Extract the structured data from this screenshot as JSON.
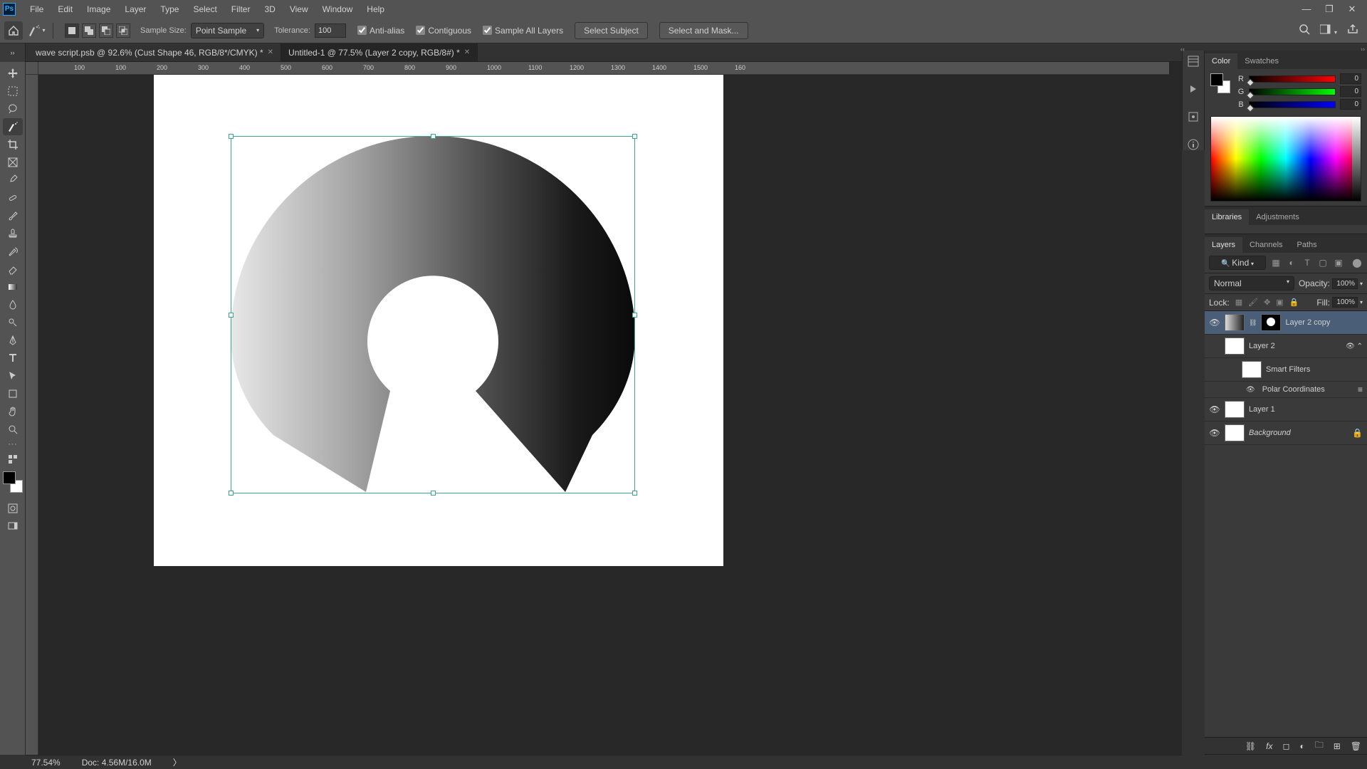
{
  "menu": [
    "File",
    "Edit",
    "Image",
    "Layer",
    "Type",
    "Select",
    "Filter",
    "3D",
    "View",
    "Window",
    "Help"
  ],
  "options": {
    "sample_size_label": "Sample Size:",
    "sample_size_value": "Point Sample",
    "tolerance_label": "Tolerance:",
    "tolerance_value": "100",
    "antialias": "Anti-alias",
    "contiguous": "Contiguous",
    "sample_all": "Sample All Layers",
    "select_subject": "Select Subject",
    "select_and_mask": "Select and Mask..."
  },
  "tabs": [
    {
      "title": "wave script.psb @ 92.6% (Cust Shape 46, RGB/8*/CMYK) *",
      "active": false
    },
    {
      "title": "Untitled-1 @ 77.5% (Layer 2 copy, RGB/8#) *",
      "active": true
    }
  ],
  "ruler_ticks": [
    "100",
    "100",
    "200",
    "300",
    "400",
    "500",
    "600",
    "700",
    "800",
    "900",
    "1000",
    "1100",
    "1200",
    "1300",
    "1400",
    "1500",
    "160"
  ],
  "status": {
    "zoom": "77.54%",
    "doc": "Doc: 4.56M/16.0M"
  },
  "color": {
    "r": "0",
    "g": "0",
    "b": "0"
  },
  "panels": {
    "color_tab": "Color",
    "swatches_tab": "Swatches",
    "libraries_tab": "Libraries",
    "adjustments_tab": "Adjustments",
    "layers_tab": "Layers",
    "channels_tab": "Channels",
    "paths_tab": "Paths"
  },
  "layers_panel": {
    "kind": "Kind",
    "blend": "Normal",
    "opacity_label": "Opacity:",
    "opacity": "100%",
    "lock_label": "Lock:",
    "fill_label": "Fill:",
    "fill": "100%",
    "items": [
      {
        "name": "Layer 2 copy",
        "sel": true,
        "vis": true,
        "hasMask": true
      },
      {
        "name": "Layer 2",
        "sel": false,
        "vis": false,
        "smart": true
      },
      {
        "name": "Smart Filters",
        "sub": true
      },
      {
        "name": "Polar Coordinates",
        "sub2": true
      },
      {
        "name": "Layer 1",
        "sel": false,
        "vis": true
      },
      {
        "name": "Background",
        "sel": false,
        "vis": true,
        "italic": true,
        "locked": true
      }
    ]
  }
}
